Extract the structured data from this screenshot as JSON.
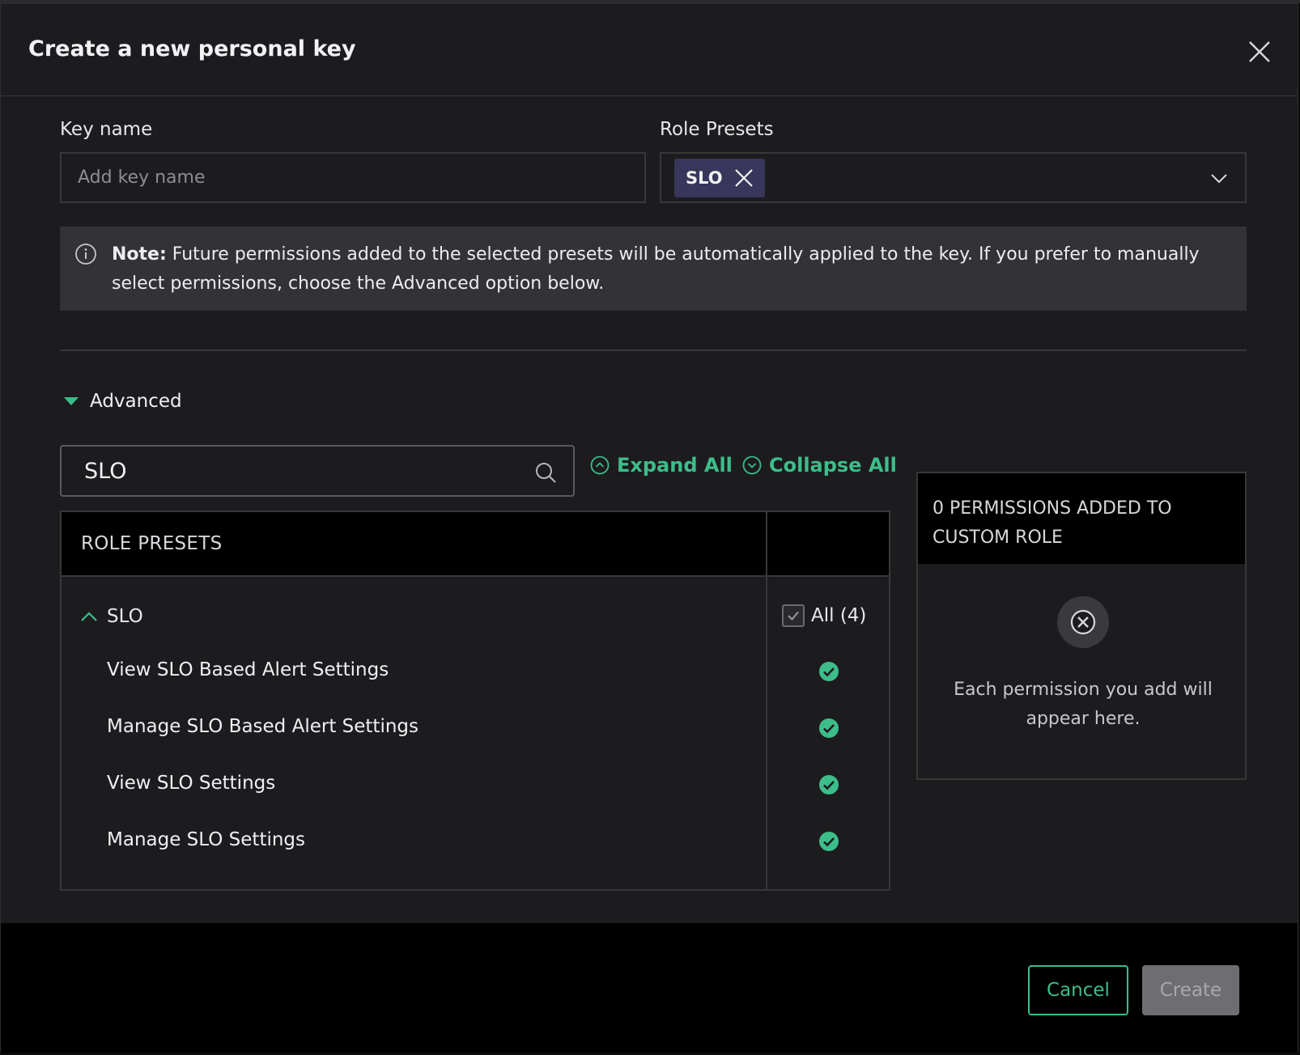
{
  "modal": {
    "title": "Create a new personal key"
  },
  "form": {
    "key_name_label": "Key name",
    "key_name_placeholder": "Add key name",
    "key_name_value": "",
    "role_presets_label": "Role Presets",
    "selected_presets": [
      "SLO"
    ]
  },
  "note": {
    "bold": "Note:",
    "text": " Future permissions added to the selected presets will be automatically applied to the key. If you prefer to manually select permissions, choose the Advanced option below."
  },
  "advanced": {
    "label": "Advanced",
    "search_value": "SLO",
    "expand_all": "Expand All",
    "collapse_all": "Collapse All",
    "table_header": "ROLE PRESETS",
    "group": {
      "label": "SLO",
      "all_label": "All (4)",
      "all_checked": true,
      "permissions": [
        {
          "label": "View SLO Based Alert Settings",
          "granted": true
        },
        {
          "label": "Manage SLO Based Alert Settings",
          "granted": true
        },
        {
          "label": "View SLO Settings",
          "granted": true
        },
        {
          "label": "Manage SLO Settings",
          "granted": true
        }
      ]
    }
  },
  "side_panel": {
    "title": "0 PERMISSIONS ADDED TO CUSTOM ROLE",
    "empty_text": "Each permission you add will appear here."
  },
  "footer": {
    "cancel": "Cancel",
    "create": "Create"
  },
  "colors": {
    "accent": "#3dbd8a",
    "chip_bg": "#38365a",
    "note_bg": "#333336"
  }
}
